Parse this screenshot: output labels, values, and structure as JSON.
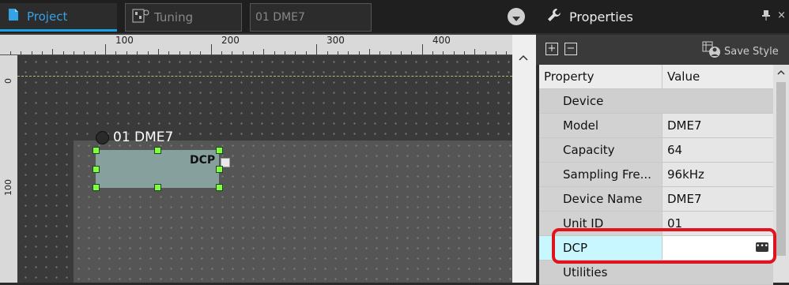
{
  "tabs": {
    "project": "Project",
    "tuning": "Tuning",
    "device": "01 DME7"
  },
  "ruler": {
    "h_labels": [
      "100",
      "200",
      "300",
      "400"
    ],
    "v_labels": [
      "0",
      "100"
    ]
  },
  "canvas": {
    "device_title": "01 DME7",
    "port_label": "DCP"
  },
  "properties": {
    "title": "Properties",
    "save_style": "Save Style",
    "headers": {
      "property": "Property",
      "value": "Value"
    },
    "rows": [
      {
        "type": "category",
        "name": "Device",
        "value": ""
      },
      {
        "type": "item",
        "name": "Model",
        "value": "DME7"
      },
      {
        "type": "item",
        "name": "Capacity",
        "value": "64"
      },
      {
        "type": "item",
        "name": "Sampling Fre...",
        "value": "96kHz"
      },
      {
        "type": "item",
        "name": "Device Name",
        "value": "DME7"
      },
      {
        "type": "item",
        "name": "Unit ID",
        "value": "01"
      },
      {
        "type": "selected",
        "name": "DCP",
        "value": ""
      },
      {
        "type": "category",
        "name": "Utilities",
        "value": ""
      }
    ]
  },
  "colors": {
    "accent": "#1ba1e2",
    "selection_handle": "#7fff3f",
    "highlight": "#e0141e",
    "selected_row": "#c9f7ff"
  },
  "icons": [
    "project-icon",
    "tuning-icon",
    "dropdown-chevron-icon",
    "wrench-icon",
    "pin-icon",
    "close-icon",
    "expand-all-icon",
    "collapse-all-icon",
    "save-style-icon",
    "edit-dialog-icon"
  ]
}
